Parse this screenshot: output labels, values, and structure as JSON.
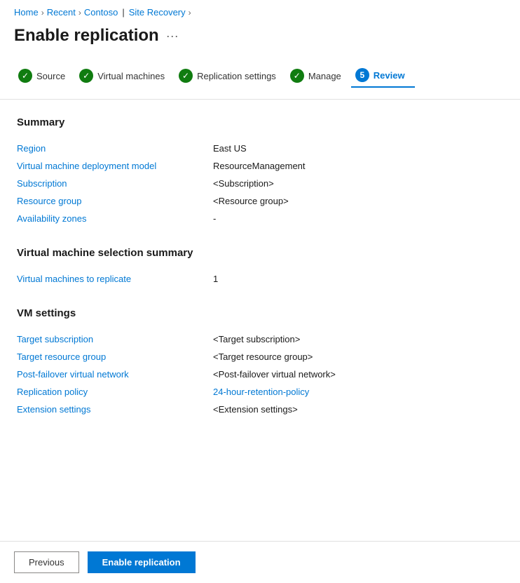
{
  "breadcrumb": {
    "home": "Home",
    "recent": "Recent",
    "contoso": "Contoso",
    "pipe": "|",
    "site_recovery": "Site Recovery",
    "sep": "›"
  },
  "page": {
    "title": "Enable replication",
    "menu_icon": "···"
  },
  "wizard": {
    "steps": [
      {
        "id": "source",
        "label": "Source",
        "state": "completed",
        "number": null
      },
      {
        "id": "virtual-machines",
        "label": "Virtual machines",
        "state": "completed",
        "number": null
      },
      {
        "id": "replication-settings",
        "label": "Replication settings",
        "state": "completed",
        "number": null
      },
      {
        "id": "manage",
        "label": "Manage",
        "state": "completed",
        "number": null
      },
      {
        "id": "review",
        "label": "Review",
        "state": "active",
        "number": "5"
      }
    ]
  },
  "summary": {
    "title": "Summary",
    "rows": [
      {
        "label": "Region",
        "value": "East US",
        "is_link": false
      },
      {
        "label": "Virtual machine deployment model",
        "value": "ResourceManagement",
        "is_link": false
      },
      {
        "label": "Subscription",
        "value": "<Subscription>",
        "is_link": false
      },
      {
        "label": "Resource group",
        "value": "<Resource group>",
        "is_link": false
      },
      {
        "label": "Availability zones",
        "value": "-",
        "is_link": false
      }
    ]
  },
  "vm_selection": {
    "title": "Virtual machine selection summary",
    "rows": [
      {
        "label": "Virtual machines to replicate",
        "value": "1",
        "is_link": false
      }
    ]
  },
  "vm_settings": {
    "title": "VM settings",
    "rows": [
      {
        "label": "Target subscription",
        "value": "<Target subscription>",
        "is_link": false
      },
      {
        "label": "Target resource group",
        "value": "<Target resource group>",
        "is_link": false
      },
      {
        "label": "Post-failover virtual network",
        "value": "<Post-failover virtual network>",
        "is_link": false
      },
      {
        "label": "Replication policy",
        "value": "24-hour-retention-policy",
        "is_link": true
      },
      {
        "label": "Extension settings",
        "value": "<Extension settings>",
        "is_link": false
      }
    ]
  },
  "footer": {
    "previous_label": "Previous",
    "enable_label": "Enable replication"
  }
}
